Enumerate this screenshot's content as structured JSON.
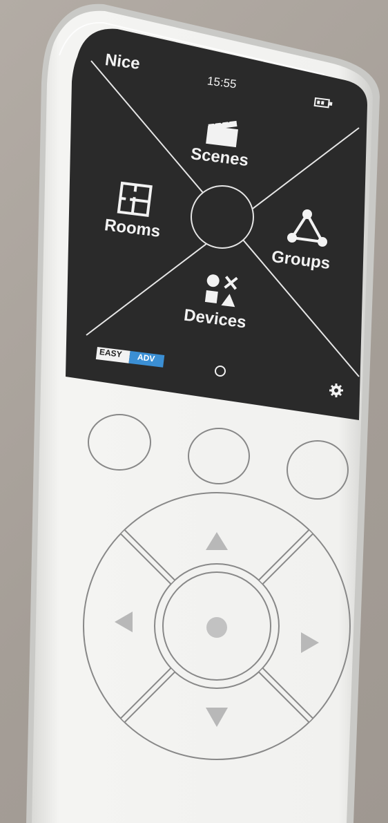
{
  "status_bar": {
    "brand": "Nice",
    "time": "15:55",
    "battery_icon": "battery-icon"
  },
  "menu": {
    "scenes": {
      "label": "Scenes",
      "icon": "clapperboard-icon"
    },
    "rooms": {
      "label": "Rooms",
      "icon": "floorplan-icon"
    },
    "groups": {
      "label": "Groups",
      "icon": "network-icon"
    },
    "devices": {
      "label": "Devices",
      "icon": "shapes-icon"
    }
  },
  "bottom_bar": {
    "mode_easy": "EASY",
    "mode_adv": "ADV",
    "home_icon": "home-circle-icon",
    "settings_icon": "gear-icon"
  },
  "colors": {
    "screen": "#2b2b2b",
    "body": "#f2f2f0",
    "accent_adv": "#3b8fd4",
    "dpad_arrow": "#b8b8b8"
  }
}
